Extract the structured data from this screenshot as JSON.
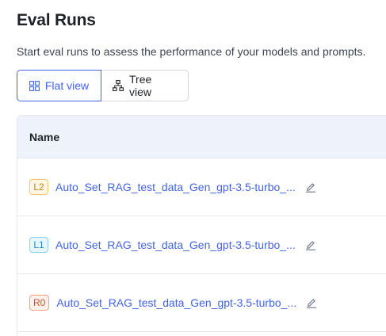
{
  "header": {
    "title": "Eval Runs",
    "subtitle": "Start eval runs to assess the performance of your models and prompts."
  },
  "view_toggle": {
    "flat_label": "Flat view",
    "tree_label": "Tree view",
    "selected": "flat"
  },
  "table": {
    "columns": [
      "Name"
    ],
    "rows": [
      {
        "badge": "L2",
        "name": "Auto_Set_RAG_test_data_Gen_gpt-3.5-turbo_..."
      },
      {
        "badge": "L1",
        "name": "Auto_Set_RAG_test_data_Gen_gpt-3.5-turbo_..."
      },
      {
        "badge": "R0",
        "name": "Auto_Set_RAG_test_data_Gen_gpt-3.5-turbo_..."
      }
    ]
  },
  "colors": {
    "accent": "#4263eb",
    "header_bg": "#eef2fb"
  },
  "icons": {
    "flat_view": "grid-icon",
    "tree_view": "hierarchy-icon",
    "edit": "pencil-icon"
  }
}
